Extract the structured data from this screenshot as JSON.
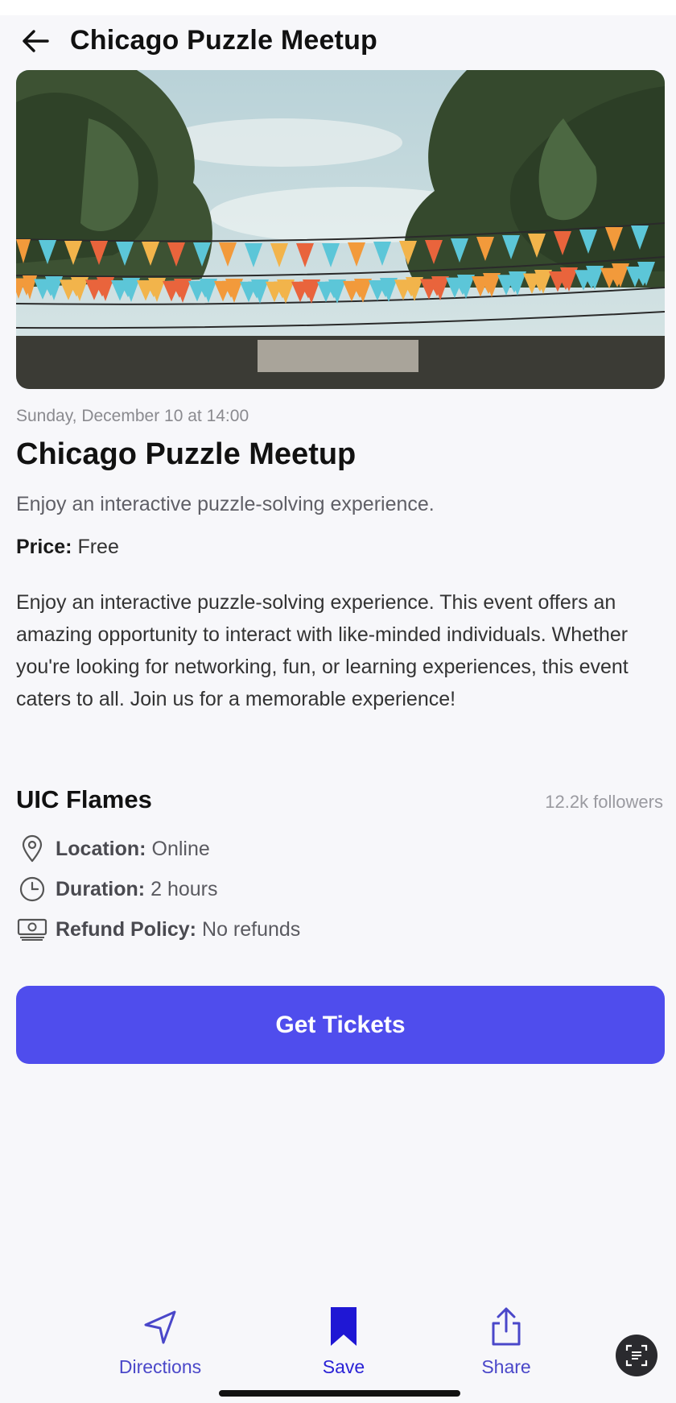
{
  "header": {
    "title": "Chicago Puzzle Meetup"
  },
  "event": {
    "date": "Sunday, December 10 at 14:00",
    "title": "Chicago Puzzle Meetup",
    "subtitle": "Enjoy an interactive puzzle-solving experience.",
    "price_label": "Price:",
    "price_value": "Free",
    "description": "Enjoy an interactive puzzle-solving experience. This event offers an amazing opportunity to interact with like-minded individuals. Whether you're looking for networking, fun, or learning experiences, this event caters to all. Join us for a memorable experience!"
  },
  "organizer": {
    "name": "UIC Flames",
    "followers": "12.2k followers"
  },
  "details": {
    "location_label": "Location:",
    "location_value": "Online",
    "duration_label": "Duration:",
    "duration_value": "2 hours",
    "refund_label": "Refund Policy:",
    "refund_value": "No refunds"
  },
  "cta": {
    "label": "Get Tickets",
    "color": "#4f4ded"
  },
  "bottom_bar": {
    "directions": "Directions",
    "save": "Save",
    "share": "Share"
  },
  "icons": {
    "back": "arrow-left-icon",
    "location": "map-pin-icon",
    "duration": "clock-icon",
    "refund": "money-icon",
    "directions": "navigation-arrow-icon",
    "save": "bookmark-icon",
    "share": "share-icon",
    "scan": "scan-text-icon"
  }
}
